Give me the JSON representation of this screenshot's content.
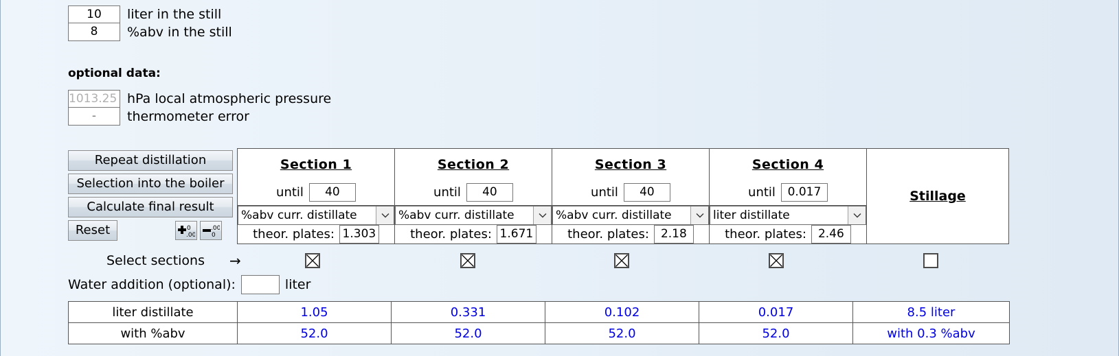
{
  "still": {
    "rows": [
      {
        "value": "10",
        "label": "liter in the still"
      },
      {
        "value": "8",
        "label": "%abv in the still"
      }
    ]
  },
  "optional": {
    "title": "optional data:",
    "rows": [
      {
        "placeholder": "1013.25",
        "value": "",
        "label": "hPa local atmospheric pressure"
      },
      {
        "value": "-",
        "label": "thermometer error"
      }
    ]
  },
  "buttons": {
    "repeat_distillation": "Repeat distillation",
    "selection_into_boiler": "Selection into the boiler",
    "calculate_final_result": "Calculate final result",
    "reset": "Reset",
    "increase_decimals_icon": "increase-decimals-icon",
    "decrease_decimals_icon": "decrease-decimals-icon"
  },
  "sections": [
    {
      "title": "Section 1",
      "until_label": "until",
      "until_value": "40",
      "mode": "%abv curr. distillate",
      "plates_label": "theor. plates:",
      "plates_value": "1.303",
      "selected": true
    },
    {
      "title": "Section 2",
      "until_label": "until",
      "until_value": "40",
      "mode": "%abv curr. distillate",
      "plates_label": "theor. plates:",
      "plates_value": "1.671",
      "selected": true
    },
    {
      "title": "Section 3",
      "until_label": "until",
      "until_value": "40",
      "mode": "%abv curr. distillate",
      "plates_label": "theor. plates:",
      "plates_value": "2.18",
      "selected": true
    },
    {
      "title": "Section 4",
      "until_label": "until",
      "until_value": "0.017",
      "mode": "liter distillate",
      "plates_label": "theor. plates:",
      "plates_value": "2.46",
      "selected": true
    }
  ],
  "stillage": {
    "title": "Stillage",
    "selected": false
  },
  "select_row": {
    "label": "Select sections",
    "arrow": "→"
  },
  "water": {
    "label": "Water addition (optional):",
    "value": "",
    "unit": "liter"
  },
  "results": {
    "rows": [
      {
        "label": "liter distillate",
        "values": [
          "1.05",
          "0.331",
          "0.102",
          "0.017"
        ],
        "stillage": "8.5 liter"
      },
      {
        "label": "with %abv",
        "values": [
          "52.0",
          "52.0",
          "52.0",
          "52.0"
        ],
        "stillage": "with 0.3 %abv"
      }
    ]
  },
  "colors": {
    "result_value": "#0000e0",
    "background": "#eaf2f9",
    "border": "#555555"
  }
}
